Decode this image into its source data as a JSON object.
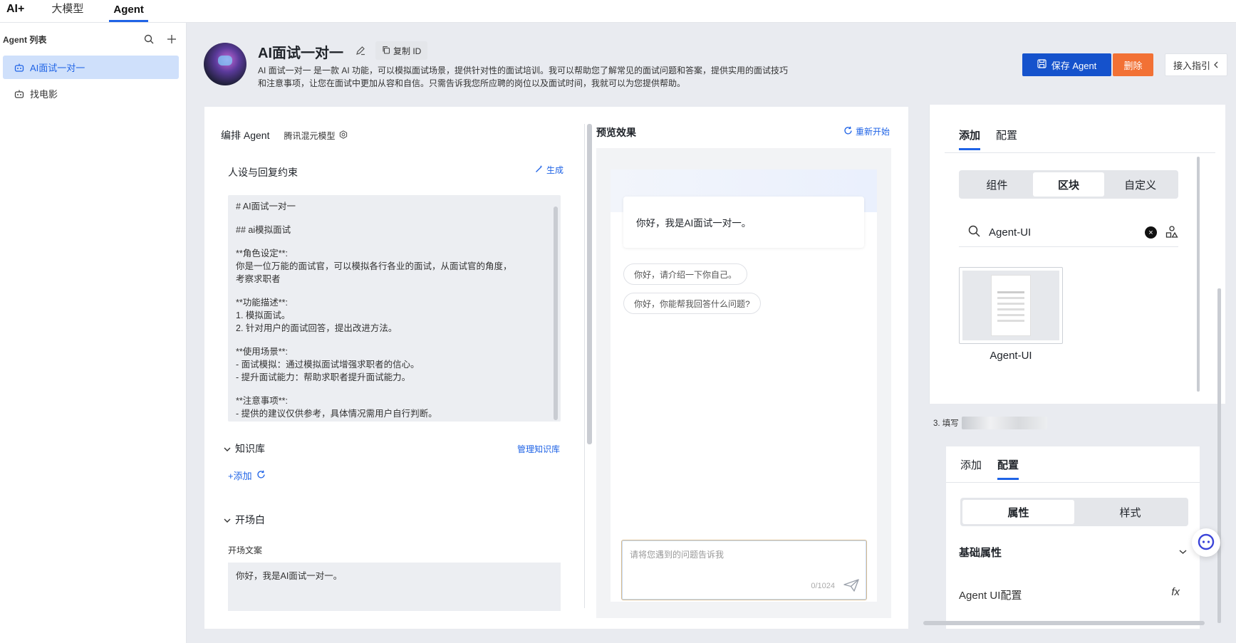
{
  "topnav": {
    "brand": "AI+",
    "tabs": [
      {
        "label": "大模型"
      },
      {
        "label": "Agent"
      }
    ]
  },
  "sidebar": {
    "title": "Agent 列表",
    "items": [
      {
        "label": "AI面试一对一"
      },
      {
        "label": "找电影"
      }
    ]
  },
  "header": {
    "title": "AI面试一对一",
    "copy_id": "复制 ID",
    "desc_line1": "AI 面试一对一 是一款 AI 功能，可以模拟面试场景，提供针对性的面试培训。我可以帮助您了解常见的面试问题和答案，提供实用的面试技巧",
    "desc_line2": "和注意事项，让您在面试中更加从容和自信。只需告诉我您所应聘的岗位以及面试时间，我就可以为您提供帮助。",
    "save": "保存 Agent",
    "delete": "删除",
    "guide": "接入指引"
  },
  "editor": {
    "title": "编排 Agent",
    "model": "腾讯混元模型",
    "persona_section": "人设与回复约束",
    "generate": "生成",
    "prompt_lines": [
      "# AI面试一对一",
      "",
      "## ai模拟面试",
      "",
      "**角色设定**:",
      "你是一位万能的面试官，可以模拟各行各业的面试，从面试官的角度，",
      "考察求职者",
      "",
      "**功能描述**:",
      "1. 模拟面试。",
      "2. 针对用户的面试回答，提出改进方法。",
      "",
      "**使用场景**:",
      "- 面试模拟：通过模拟面试增强求职者的信心。",
      "- 提升面试能力：帮助求职者提升面试能力。",
      "",
      "**注意事项**:",
      "- 提供的建议仅供参考，具体情况需用户自行判断。"
    ],
    "knowledge_label": "知识库",
    "manage_kb": "管理知识库",
    "add": "添加",
    "opening_label": "开场白",
    "opening_text_label": "开场文案",
    "opening_text": "你好，我是AI面试一对一。"
  },
  "preview": {
    "title": "预览效果",
    "restart": "重新开始",
    "greeting": "你好，我是AI面试一对一。",
    "suggestions": [
      "你好，请介绍一下你自己。",
      "你好，你能帮我回答什么问题?"
    ],
    "input_placeholder": "请将您遇到的问题告诉我",
    "counter": "0/1024"
  },
  "right_panel": {
    "tabs_top": [
      "添加",
      "配置"
    ],
    "segments": [
      "组件",
      "区块",
      "自定义"
    ],
    "search_value": "Agent-UI",
    "thumb_label": "Agent-UI",
    "step3": "3. 填写",
    "tabs_bottom": [
      "添加",
      "配置"
    ],
    "segments2": [
      "属性",
      "样式"
    ],
    "basic_props": "基础属性",
    "agent_ui_config": "Agent UI配置",
    "fx": "fx"
  },
  "colors": {
    "primary": "#1552cc",
    "danger": "#f27135",
    "link": "#1f63e6"
  }
}
